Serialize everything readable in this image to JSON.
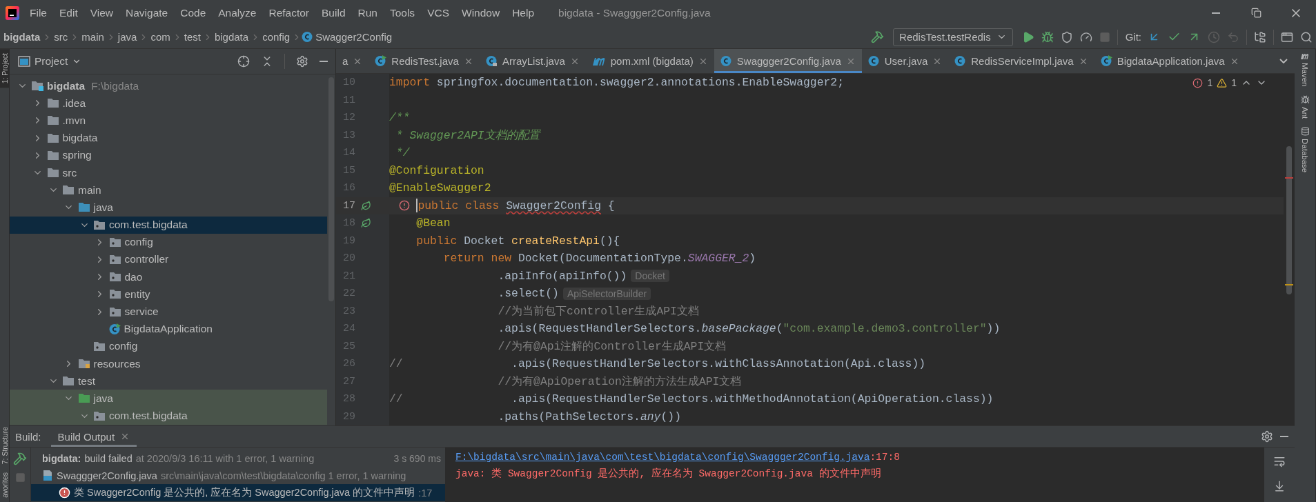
{
  "menu_bar": {
    "items": [
      "File",
      "Edit",
      "View",
      "Navigate",
      "Code",
      "Analyze",
      "Refactor",
      "Build",
      "Run",
      "Tools",
      "VCS",
      "Window",
      "Help"
    ],
    "title": "bigdata - Swaggger2Config.java"
  },
  "breadcrumbs": [
    {
      "label": "bigdata",
      "kind": "project"
    },
    {
      "label": "src",
      "kind": "dir"
    },
    {
      "label": "main",
      "kind": "dir"
    },
    {
      "label": "java",
      "kind": "dir"
    },
    {
      "label": "com",
      "kind": "dir"
    },
    {
      "label": "test",
      "kind": "dir"
    },
    {
      "label": "bigdata",
      "kind": "dir"
    },
    {
      "label": "config",
      "kind": "dir"
    },
    {
      "label": "Swagger2Config",
      "kind": "class"
    }
  ],
  "toolbar": {
    "run_config": "RedisTest.testRedis",
    "git_label": "Git:"
  },
  "left_stripe": [
    {
      "label": "1: Project",
      "selected": true
    },
    {
      "label": "7: Structure",
      "selected": false
    },
    {
      "label": "avorites",
      "selected": false
    }
  ],
  "right_stripe": [
    {
      "label": "Maven",
      "kind": "maven"
    },
    {
      "label": "Ant",
      "kind": "ant"
    },
    {
      "label": "Database",
      "kind": "database"
    }
  ],
  "project_panel": {
    "title": "Project",
    "tree": [
      {
        "label": "bigdata",
        "path": "F:\\bigdata",
        "kind": "module",
        "expanded": true,
        "selected": false,
        "test": false,
        "children": [
          {
            "label": ".idea",
            "kind": "folder",
            "expanded": false,
            "selected": false,
            "test": false
          },
          {
            "label": ".mvn",
            "kind": "folder",
            "expanded": false,
            "selected": false,
            "test": false
          },
          {
            "label": "bigdata",
            "kind": "folder",
            "expanded": false,
            "selected": false,
            "test": false
          },
          {
            "label": "spring",
            "kind": "folder",
            "expanded": false,
            "selected": false,
            "test": false
          },
          {
            "label": "src",
            "kind": "folder",
            "expanded": true,
            "selected": false,
            "test": false,
            "children": [
              {
                "label": "main",
                "kind": "folder",
                "expanded": true,
                "selected": false,
                "test": false,
                "children": [
                  {
                    "label": "java",
                    "kind": "source",
                    "expanded": true,
                    "selected": false,
                    "test": false,
                    "children": [
                      {
                        "label": "com.test.bigdata",
                        "kind": "package",
                        "expanded": true,
                        "selected": true,
                        "test": false,
                        "children": [
                          {
                            "label": "config",
                            "kind": "package",
                            "expanded": false,
                            "selected": false,
                            "test": false
                          },
                          {
                            "label": "controller",
                            "kind": "package",
                            "expanded": false,
                            "selected": false,
                            "test": false
                          },
                          {
                            "label": "dao",
                            "kind": "package",
                            "expanded": false,
                            "selected": false,
                            "test": false
                          },
                          {
                            "label": "entity",
                            "kind": "package",
                            "expanded": false,
                            "selected": false,
                            "test": false
                          },
                          {
                            "label": "service",
                            "kind": "package",
                            "expanded": false,
                            "selected": false,
                            "test": false
                          },
                          {
                            "label": "BigdataApplication",
                            "kind": "spring-class",
                            "selected": false,
                            "test": false
                          }
                        ]
                      },
                      {
                        "label": "config",
                        "kind": "package",
                        "selected": false,
                        "test": false
                      }
                    ]
                  },
                  {
                    "label": "resources",
                    "kind": "resources",
                    "expanded": false,
                    "selected": false,
                    "test": false
                  }
                ]
              },
              {
                "label": "test",
                "kind": "folder",
                "expanded": true,
                "selected": false,
                "test": false,
                "children": [
                  {
                    "label": "java",
                    "kind": "test-source",
                    "expanded": true,
                    "selected": false,
                    "test": true,
                    "children": [
                      {
                        "label": "com.test.bigdata",
                        "kind": "package",
                        "expanded": true,
                        "selected": false,
                        "test": true
                      }
                    ]
                  }
                ]
              }
            ]
          }
        ]
      }
    ]
  },
  "editor": {
    "tabs": [
      {
        "label": "a",
        "kind": "cut",
        "selected": false
      },
      {
        "label": "RedisTest.java",
        "kind": "test-class",
        "selected": false
      },
      {
        "label": "ArrayList.java",
        "kind": "library-class",
        "selected": false
      },
      {
        "label": "pom.xml (bigdata)",
        "kind": "maven",
        "selected": false
      },
      {
        "label": "Swaggger2Config.java",
        "kind": "class",
        "selected": true
      },
      {
        "label": "User.java",
        "kind": "class",
        "selected": false
      },
      {
        "label": "RedisServiceImpl.java",
        "kind": "class",
        "selected": false
      },
      {
        "label": "BigdataApplication.java",
        "kind": "spring-class",
        "selected": false
      }
    ],
    "problems": {
      "errors": "1",
      "warnings": "1"
    },
    "lines": [
      {
        "number": "10",
        "current": false,
        "error": false,
        "bean": false,
        "tokens": [
          {
            "kind": "keyword",
            "text": "import"
          },
          {
            "kind": "plain",
            "text": " springfox.documentation.swagger2.annotations.EnableSwagger2;"
          }
        ]
      },
      {
        "number": "11",
        "current": false,
        "error": false,
        "bean": false
      },
      {
        "number": "12",
        "current": false,
        "error": false,
        "bean": false,
        "tokens": [
          {
            "kind": "doc",
            "text": "/**"
          }
        ]
      },
      {
        "number": "13",
        "current": false,
        "error": false,
        "bean": false,
        "tokens": [
          {
            "kind": "doc",
            "text": " * Swagger2API文档的配置"
          }
        ]
      },
      {
        "number": "14",
        "current": false,
        "error": false,
        "bean": false,
        "tokens": [
          {
            "kind": "doc",
            "text": " */"
          }
        ]
      },
      {
        "number": "15",
        "current": false,
        "error": false,
        "bean": false,
        "tokens": [
          {
            "kind": "annotation",
            "text": "@Configuration"
          }
        ]
      },
      {
        "number": "16",
        "current": false,
        "error": false,
        "bean": false,
        "tokens": [
          {
            "kind": "annotation",
            "text": "@EnableSwagger2"
          }
        ]
      },
      {
        "number": "17",
        "current": true,
        "error": true,
        "bean": true,
        "tokens": [
          {
            "kind": "keyword",
            "text": "public class "
          },
          {
            "kind": "flagged",
            "text": "Swagger2Config"
          },
          {
            "kind": "plain",
            "text": " {"
          }
        ]
      },
      {
        "number": "18",
        "current": false,
        "error": false,
        "bean": true,
        "tokens": [
          {
            "kind": "annotation",
            "text": "    @Bean"
          }
        ]
      },
      {
        "number": "19",
        "current": false,
        "error": false,
        "bean": false,
        "tokens": [
          {
            "kind": "keyword",
            "text": "    public "
          },
          {
            "kind": "plain",
            "text": "Docket "
          },
          {
            "kind": "method",
            "text": "createRestApi"
          },
          {
            "kind": "plain",
            "text": "(){"
          }
        ]
      },
      {
        "number": "20",
        "current": false,
        "error": false,
        "bean": false,
        "tokens": [
          {
            "kind": "keyword",
            "text": "        return new "
          },
          {
            "kind": "plain",
            "text": "Docket(DocumentationType."
          },
          {
            "kind": "field",
            "text": "SWAGGER_2"
          },
          {
            "kind": "plain",
            "text": ")"
          }
        ]
      },
      {
        "number": "21",
        "current": false,
        "error": false,
        "bean": false,
        "hint": "Docket",
        "tokens": [
          {
            "kind": "plain",
            "text": "                .apiInfo(apiInfo())"
          }
        ]
      },
      {
        "number": "22",
        "current": false,
        "error": false,
        "bean": false,
        "hint": "ApiSelectorBuilder",
        "tokens": [
          {
            "kind": "plain",
            "text": "                .select()"
          }
        ]
      },
      {
        "number": "23",
        "current": false,
        "error": false,
        "bean": false,
        "tokens": [
          {
            "kind": "comment",
            "text": "                //为当前包下controller生成API文档"
          }
        ]
      },
      {
        "number": "24",
        "current": false,
        "error": false,
        "bean": false,
        "tokens": [
          {
            "kind": "plain",
            "text": "                .apis(RequestHandlerSelectors."
          },
          {
            "kind": "call",
            "text": "basePackage"
          },
          {
            "kind": "plain",
            "text": "("
          },
          {
            "kind": "string",
            "text": "\"com.example.demo3.controller\""
          },
          {
            "kind": "plain",
            "text": "))"
          }
        ]
      },
      {
        "number": "25",
        "current": false,
        "error": false,
        "bean": false,
        "tokens": [
          {
            "kind": "comment",
            "text": "                //为有@Api注解的Controller生成API文档"
          }
        ]
      },
      {
        "number": "26",
        "current": false,
        "error": false,
        "bean": false,
        "tokens": [
          {
            "kind": "comment",
            "text": "//"
          },
          {
            "kind": "plain",
            "text": "                .apis(RequestHandlerSelectors.withClassAnnotation(Api.class))"
          }
        ]
      },
      {
        "number": "27",
        "current": false,
        "error": false,
        "bean": false,
        "tokens": [
          {
            "kind": "comment",
            "text": "                //为有@ApiOperation注解的方法生成API文档"
          }
        ]
      },
      {
        "number": "28",
        "current": false,
        "error": false,
        "bean": false,
        "tokens": [
          {
            "kind": "comment",
            "text": "//"
          },
          {
            "kind": "plain",
            "text": "                .apis(RequestHandlerSelectors.withMethodAnnotation(ApiOperation.class))"
          }
        ]
      },
      {
        "number": "29",
        "current": false,
        "error": false,
        "bean": false,
        "tokens": [
          {
            "kind": "plain",
            "text": "                .paths(PathSelectors."
          },
          {
            "kind": "call",
            "text": "any"
          },
          {
            "kind": "plain",
            "text": "())"
          }
        ]
      }
    ]
  },
  "build": {
    "title": "Build:",
    "tabs": [
      {
        "label": "Build Output",
        "selected": true
      }
    ],
    "rows": [
      {
        "kind": "summary",
        "selected": false,
        "project": "bigdata:",
        "status": "build failed",
        "detail": "at 2020/9/3 16:11 with 1 error, 1 warning",
        "time": "3 s 690 ms"
      },
      {
        "kind": "file",
        "selected": false,
        "file": "Swaggger2Config.java",
        "detail": "src\\main\\java\\com\\test\\bigdata\\config 1 error, 1 warning"
      },
      {
        "kind": "error",
        "selected": true,
        "message": "类 Swagger2Config 是公共的, 应在名为 Swagger2Config.java 的文件中声明",
        "location": ":17"
      }
    ],
    "console": [
      {
        "link": "F:\\bigdata\\src\\main\\java\\com\\test\\bigdata\\config\\Swaggger2Config.java",
        "suffix": ":17:8"
      },
      {
        "text": "java: 类 Swagger2Config 是公共的, 应在名为 Swagger2Config.java 的文件中声明"
      }
    ]
  }
}
